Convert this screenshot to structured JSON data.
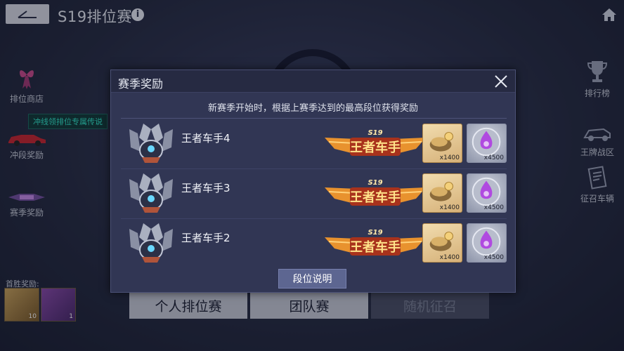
{
  "header": {
    "title": "S19排位赛",
    "info_glyph": "i"
  },
  "sidebar_left": [
    {
      "label": "排位商店",
      "icon": "bow-icon"
    },
    {
      "label": "冲段奖励",
      "icon": "car-icon"
    },
    {
      "label": "赛季奖励",
      "icon": "season-logo-icon"
    }
  ],
  "sidebar_right": [
    {
      "label": "排行榜",
      "icon": "trophy-icon"
    },
    {
      "label": "王牌战区",
      "icon": "racecar-icon"
    },
    {
      "label": "征召车辆",
      "icon": "document-icon"
    }
  ],
  "promo_tag": "冲线领排位专属传说",
  "first_win": {
    "label": "首胜奖励:",
    "items": [
      {
        "count": "10",
        "color": "#c9a25a"
      },
      {
        "count": "1",
        "color": "#8a4aa8"
      }
    ]
  },
  "bottom_tabs": [
    "个人排位赛",
    "团队赛",
    "随机征召"
  ],
  "modal": {
    "title": "赛季奖励",
    "description": "新赛季开始时，根据上赛季达到的最高段位获得奖励",
    "rows": [
      {
        "rank": "王者车手4",
        "badge_season": "S19",
        "badge_text": "王者车手",
        "items": [
          {
            "qty": "x1400"
          },
          {
            "qty": "x4500"
          }
        ]
      },
      {
        "rank": "王者车手3",
        "badge_season": "S19",
        "badge_text": "王者车手",
        "items": [
          {
            "qty": "x1400"
          },
          {
            "qty": "x4500"
          }
        ]
      },
      {
        "rank": "王者车手2",
        "badge_season": "S19",
        "badge_text": "王者车手",
        "items": [
          {
            "qty": "x1400"
          },
          {
            "qty": "x4500"
          }
        ]
      }
    ],
    "explain_button": "段位说明"
  },
  "colors": {
    "modal_bg": "#313654",
    "accent_gold": "#f2a43a",
    "accent_purple": "#b04ae0",
    "button": "#5d6691"
  }
}
